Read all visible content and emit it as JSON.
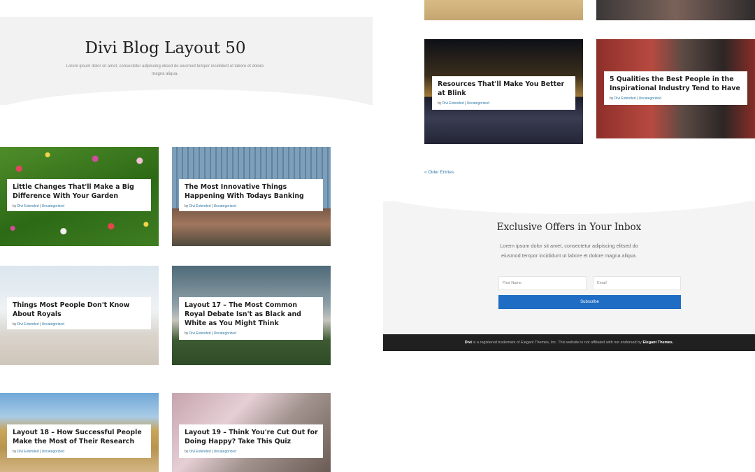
{
  "left": {
    "hero": {
      "title": "Divi Blog Layout 50",
      "subtitle": "Lorem ipsum dolor sit amet, consectetur adipiscing elised do eiusmod tempor incididunt ut labore et dolore magna aliqua."
    },
    "posts": [
      {
        "title": "Little Changes That'll Make a Big Difference With Your Garden",
        "author": "Divi Extended",
        "category": "Uncategorized"
      },
      {
        "title": "The Most Innovative Things Happening With Todays Banking",
        "author": "Divi Extended",
        "category": "Uncategorized"
      },
      {
        "title": "Things Most People Don't Know About Royals",
        "author": "Divi Extended",
        "category": "Uncategorized"
      },
      {
        "title": "Layout 17 – The Most Common Royal Debate Isn't as Black and White as You Might Think",
        "author": "Divi Extended",
        "category": "Uncategorized"
      },
      {
        "title": "Layout 18 – How Successful People Make the Most of Their Research",
        "author": "Divi Extended",
        "category": "Uncategorized"
      },
      {
        "title": "Layout 19 – Think You're Cut Out for Doing Happy? Take This Quiz",
        "author": "Divi Extended",
        "category": "Uncategorized"
      }
    ]
  },
  "right": {
    "posts": [
      {
        "title": "Resources That'll Make You Better at Blink",
        "author": "Divi Extended",
        "category": "Uncategorized"
      },
      {
        "title": "5 Qualities the Best People in the Inspirational Industry Tend to Have",
        "author": "Divi Extended",
        "category": "Uncategorized"
      }
    ],
    "older_entries": "« Older Entries",
    "newsletter": {
      "title": "Exclusive Offers in Your Inbox",
      "text": "Lorem ipsum dolor sit amet, consectetur adipiscing elitsed do eiusmod tempor incididunt ut labore et dolore magna aliqua.",
      "first_name_placeholder": "First Name",
      "email_placeholder": "Email",
      "subscribe_label": "Subscribe"
    },
    "footer": {
      "brand": "Divi",
      "text": "is a registered trademark of Elegant Themes, Inc. This website is not affiliated with nor endorsed by",
      "company": "Elegant Themes."
    }
  },
  "meta_by": "by",
  "meta_sep": "|",
  "colors": {
    "link": "#2e78a6",
    "button": "#1f6cc4",
    "footer_bg": "#202020"
  }
}
